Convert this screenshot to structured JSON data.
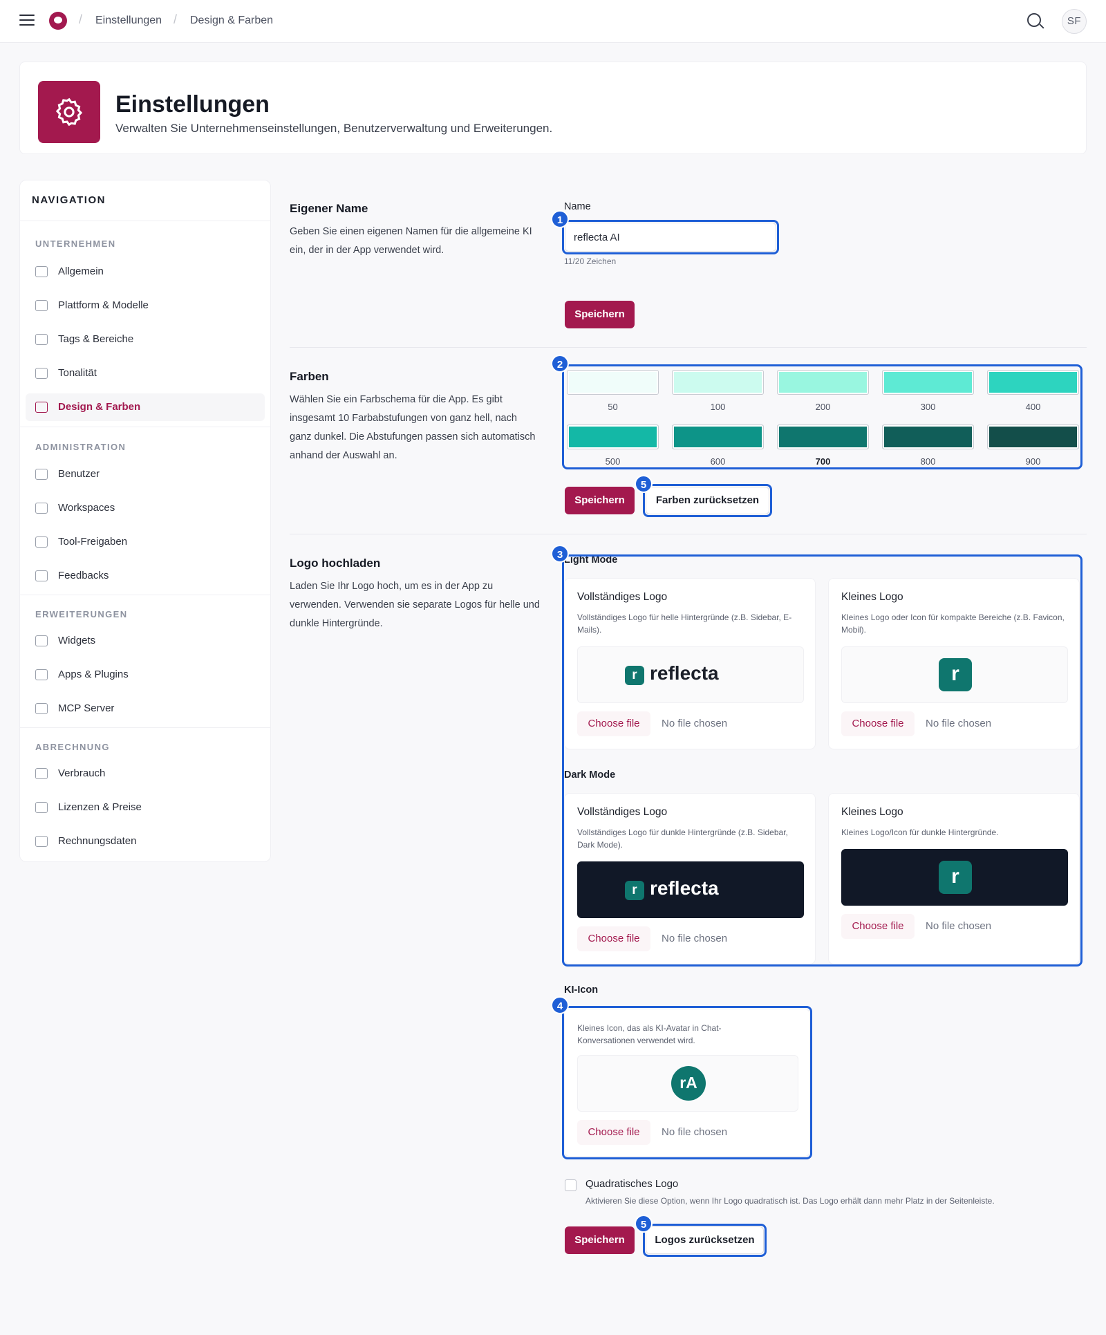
{
  "topbar": {
    "breadcrumb": [
      "Einstellungen",
      "Design & Farben"
    ],
    "avatar_initials": "SF"
  },
  "header": {
    "title": "Einstellungen",
    "subtitle": "Verwalten Sie Unternehmenseinstellungen, Benutzerverwaltung und Erweiterungen.",
    "accent_color": "#a3194e"
  },
  "nav": {
    "title": "NAVIGATION",
    "sections": [
      {
        "label": "UNTERNEHMEN",
        "items": [
          "Allgemein",
          "Plattform & Modelle",
          "Tags & Bereiche",
          "Tonalität",
          "Design & Farben"
        ]
      },
      {
        "label": "ADMINISTRATION",
        "items": [
          "Benutzer",
          "Workspaces",
          "Tool-Freigaben",
          "Feedbacks"
        ]
      },
      {
        "label": "ERWEITERUNGEN",
        "items": [
          "Widgets",
          "Apps & Plugins",
          "MCP Server"
        ]
      },
      {
        "label": "ABRECHNUNG",
        "items": [
          "Verbrauch",
          "Lizenzen & Preise",
          "Rechnungsdaten"
        ]
      }
    ],
    "active_item": "Design & Farben"
  },
  "name_section": {
    "title": "Eigener Name",
    "description": "Geben Sie einen eigenen Namen für die allgemeine KI ein, der in der App verwendet wird.",
    "field_label": "Name",
    "field_value": "reflecta AI",
    "char_count": "11/20 Zeichen",
    "save_label": "Speichern"
  },
  "colors_section": {
    "title": "Farben",
    "description": "Wählen Sie ein Farbschema für die App. Es gibt insgesamt 10 Farbabstufungen von ganz hell, nach ganz dunkel. Die Abstufungen passen sich automatisch anhand der Auswahl an.",
    "swatches": [
      {
        "label": "50",
        "color": "#f0fdfa"
      },
      {
        "label": "100",
        "color": "#ccfbef"
      },
      {
        "label": "200",
        "color": "#99f6e0"
      },
      {
        "label": "300",
        "color": "#5eead4"
      },
      {
        "label": "400",
        "color": "#2dd4bf"
      },
      {
        "label": "500",
        "color": "#14b8a6"
      },
      {
        "label": "600",
        "color": "#0d9488"
      },
      {
        "label": "700",
        "color": "#0f766e"
      },
      {
        "label": "800",
        "color": "#115e59"
      },
      {
        "label": "900",
        "color": "#134e4a"
      }
    ],
    "selected_swatch": "700",
    "save_label": "Speichern",
    "reset_label": "Farben zurücksetzen"
  },
  "logo_section": {
    "title": "Logo hochladen",
    "description": "Laden Sie Ihr Logo hoch, um es in der App zu verwenden. Verwenden sie separate Logos für helle und dunkle Hintergründe.",
    "light_mode_label": "Light Mode",
    "dark_mode_label": "Dark Mode",
    "light_full": {
      "title": "Vollständiges Logo",
      "description": "Vollständiges Logo für helle Hintergründe (z.B. Sidebar, E-Mails)."
    },
    "light_small": {
      "title": "Kleines Logo",
      "description": "Kleines Logo oder Icon für kompakte Bereiche (z.B. Favicon, Mobil)."
    },
    "dark_full": {
      "title": "Vollständiges Logo",
      "description": "Vollständiges Logo für dunkle Hintergründe (z.B. Sidebar, Dark Mode)."
    },
    "dark_small": {
      "title": "Kleines Logo",
      "description": "Kleines Logo/Icon für dunkle Hintergründe."
    },
    "wordmark_text": "reflecta",
    "wordmark_letter": "r",
    "ki_icon": {
      "label": "KI-Icon",
      "description": "Kleines Icon, das als KI-Avatar in Chat-Konversationen verwendet wird.",
      "avatar_text": "rA"
    },
    "choose_file_label": "Choose file",
    "no_file_label": "No file chosen",
    "square_logo": {
      "label": "Quadratisches Logo",
      "description": "Aktivieren Sie diese Option, wenn Ihr Logo quadratisch ist. Das Logo erhält dann mehr Platz in der Seitenleiste.",
      "checked": false
    },
    "save_label": "Speichern",
    "reset_label": "Logos zurücksetzen"
  },
  "annotations": {
    "badge_1": "1",
    "badge_2": "2",
    "badge_3": "3",
    "badge_4": "4",
    "badge_5": "5",
    "highlight_color": "#1f5fd6"
  }
}
